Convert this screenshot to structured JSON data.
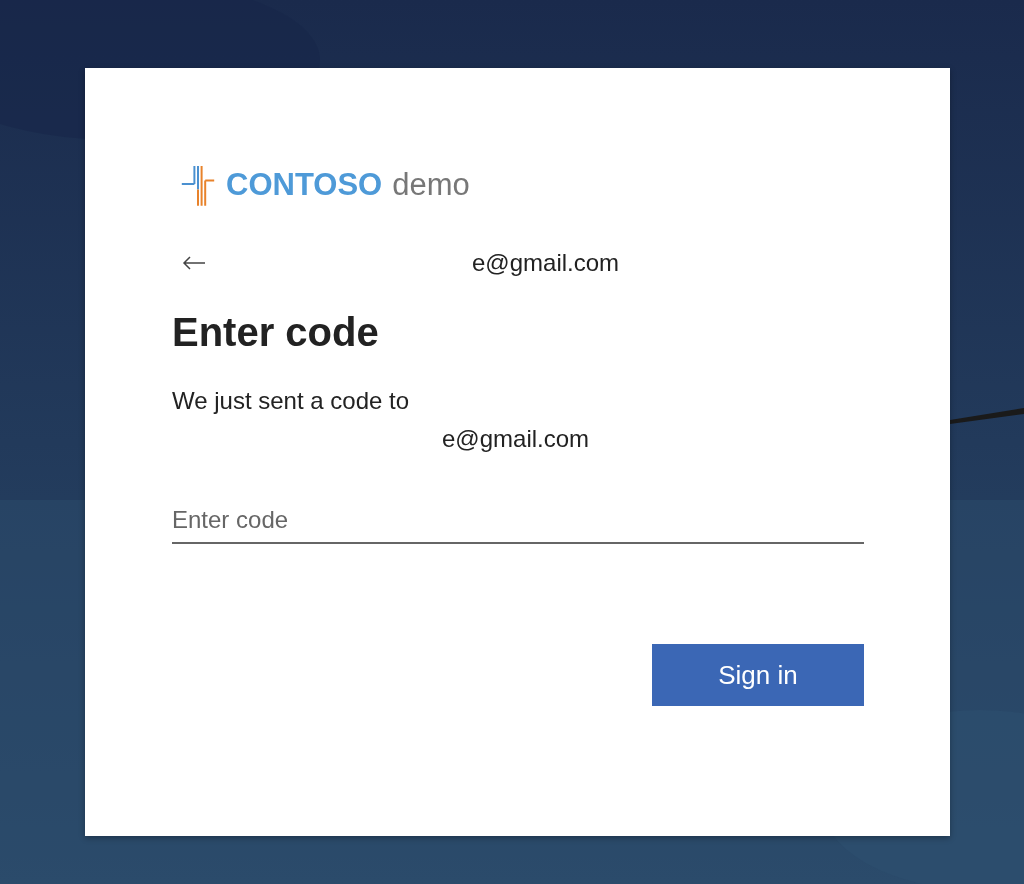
{
  "brand": {
    "name": "CONTOSO",
    "suffix": "demo"
  },
  "identity": {
    "email": "e@gmail.com"
  },
  "title": "Enter code",
  "message": {
    "text": "We just sent a code to",
    "email": "e@gmail.com"
  },
  "code_field": {
    "placeholder": "Enter code"
  },
  "buttons": [
    {
      "label": "Sign in",
      "kind": "primary"
    }
  ]
}
